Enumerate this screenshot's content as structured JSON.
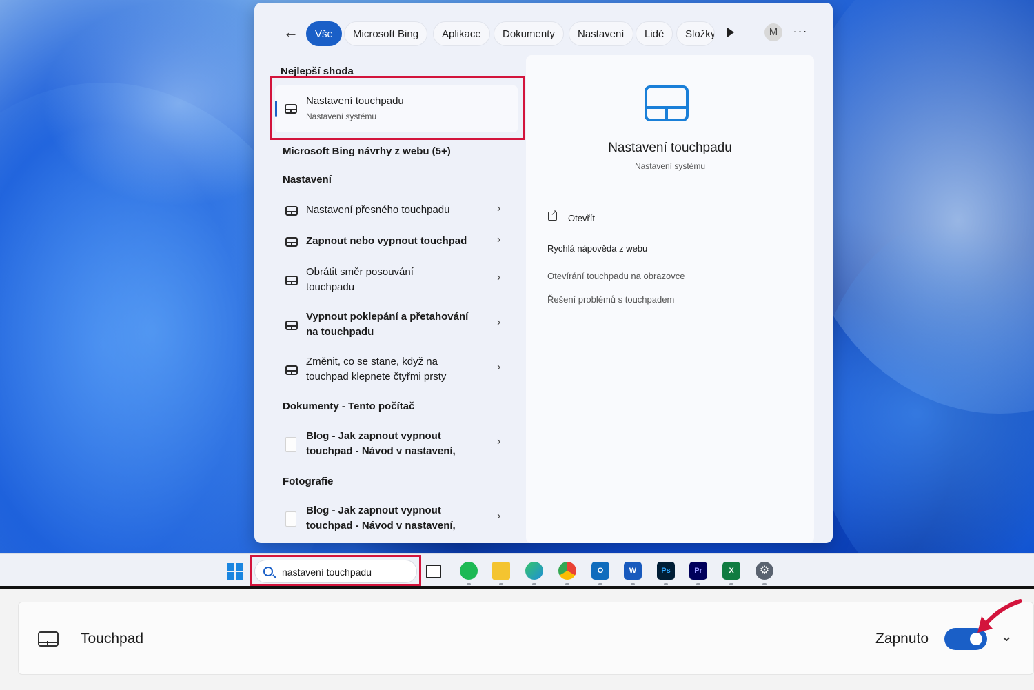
{
  "search_panel": {
    "filters": [
      {
        "label": "Vše",
        "active": true
      },
      {
        "label": "Microsoft Bing"
      },
      {
        "label": "Aplikace"
      },
      {
        "label": "Dokumenty"
      },
      {
        "label": "Nastavení"
      },
      {
        "label": "Lidé"
      },
      {
        "label": "Složky"
      }
    ],
    "avatar_letter": "M",
    "best_match_header": "Nejlepší shoda",
    "best_match": {
      "title": "Nastavení touchpadu",
      "subtitle": "Nastavení systému"
    },
    "bing_header": "Microsoft Bing návrhy z webu (5+)",
    "settings_header": "Nastavení",
    "settings_items": [
      "Nastavení přesného touchpadu",
      "Zapnout nebo vypnout touchpad",
      "Obrátit směr posouvání touchpadu",
      "Vypnout poklepání a přetahování na touchpadu",
      "Změnit, co se stane, když na touchpad klepnete čtyřmi prsty"
    ],
    "documents_header": "Dokumenty - Tento počítač",
    "documents_items": [
      "Blog - Jak zapnout vypnout touchpad - Návod v nastavení,"
    ],
    "photos_header": "Fotografie",
    "photos_items": [
      "Blog - Jak zapnout vypnout touchpad - Návod v nastavení,"
    ],
    "detail": {
      "title": "Nastavení touchpadu",
      "subtitle": "Nastavení systému",
      "open_label": "Otevřít",
      "web_help_header": "Rychlá nápověda z webu",
      "web_links": [
        "Otevírání touchpadu na obrazovce",
        "Řešení problémů s touchpadem"
      ]
    }
  },
  "taskbar": {
    "search_value": "nastavení touchpadu",
    "apps": [
      {
        "icon": "task-view-icon",
        "color": "#222222"
      },
      {
        "icon": "spotify-icon",
        "color": "#1db954"
      },
      {
        "icon": "file-explorer-icon",
        "color": "#f4c430"
      },
      {
        "icon": "edge-icon",
        "color": "#1f8fd8"
      },
      {
        "icon": "chrome-icon",
        "color": "#e94235"
      },
      {
        "icon": "outlook-icon",
        "color": "#0f6cbd",
        "text": "O"
      },
      {
        "icon": "word-icon",
        "color": "#185abd",
        "text": "W"
      },
      {
        "icon": "photoshop-icon",
        "color": "#001e36",
        "text": "Ps"
      },
      {
        "icon": "premiere-icon",
        "color": "#00005b",
        "text": "Pr"
      },
      {
        "icon": "excel-icon",
        "color": "#107c41",
        "text": "X"
      },
      {
        "icon": "settings-gear-icon",
        "color": "#5a6370"
      }
    ]
  },
  "touchpad_setting": {
    "label": "Touchpad",
    "status": "Zapnuto",
    "enabled": true
  },
  "colors": {
    "accent": "#1a5fc7",
    "highlight_red": "#d3143c"
  }
}
